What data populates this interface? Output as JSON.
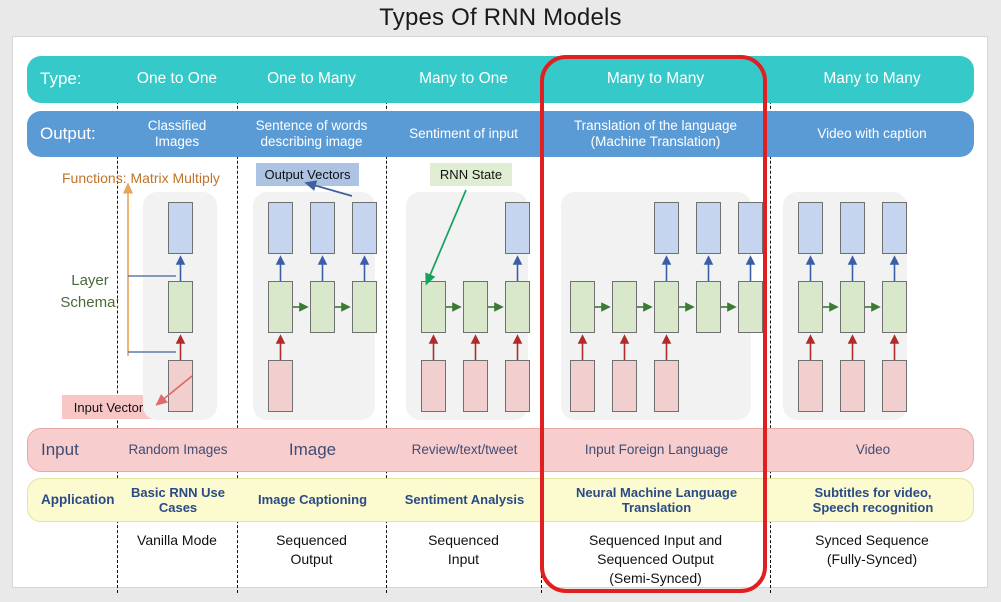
{
  "title": "Types Of RNN Models",
  "row_labels": {
    "type": "Type:",
    "output": "Output:",
    "input": "Input",
    "application": "Application"
  },
  "annotations": {
    "functions": "Functions: Matrix Multiply",
    "layer_schema": "Layer\nSchema:",
    "input_vector": "Input Vector",
    "output_vectors": "Output Vectors",
    "rnn_state": "RNN State"
  },
  "colors": {
    "type_row": "#35c9c9",
    "output_row": "#5b9bd5",
    "input_row": "#f8cdcd",
    "application_row": "#fbfbcf",
    "highlight": "#e02020",
    "output_block": "#c5d4ef",
    "hidden_block": "#d9e8cb",
    "input_block": "#f2cfcf"
  },
  "columns": [
    {
      "type": "One to One",
      "output": "Classified\nImages",
      "input": "Random Images",
      "application": "Basic RNN Use\nCases",
      "mode": "Vanilla Mode",
      "schema": {
        "inputs": 1,
        "hidden": 1,
        "outputs": 1
      },
      "highlighted": false
    },
    {
      "type": "One to Many",
      "output": "Sentence of words\ndescribing image",
      "input": "Image",
      "application": "Image Captioning",
      "mode": "Sequenced\nOutput",
      "schema": {
        "inputs": 1,
        "hidden": 3,
        "outputs": 3
      },
      "highlighted": false
    },
    {
      "type": "Many to One",
      "output": "Sentiment of input",
      "input": "Review/text/tweet",
      "application": "Sentiment Analysis",
      "mode": "Sequenced\nInput",
      "schema": {
        "inputs": 3,
        "hidden": 3,
        "outputs": 1
      },
      "highlighted": false
    },
    {
      "type": "Many to Many",
      "output": "Translation of the language\n(Machine Translation)",
      "input": "Input Foreign Language",
      "application": "Neural Machine Language\nTranslation",
      "mode": "Sequenced Input and\nSequenced Output\n(Semi-Synced)",
      "schema": {
        "inputs": 3,
        "hidden": 5,
        "outputs": 3
      },
      "highlighted": true
    },
    {
      "type": "Many to Many",
      "output": "Video with caption",
      "input": "Video",
      "application": "Subtitles for video,\nSpeech recognition",
      "mode": "Synced Sequence\n(Fully-Synced)",
      "schema": {
        "inputs": 3,
        "hidden": 3,
        "outputs": 3
      },
      "highlighted": false
    }
  ]
}
